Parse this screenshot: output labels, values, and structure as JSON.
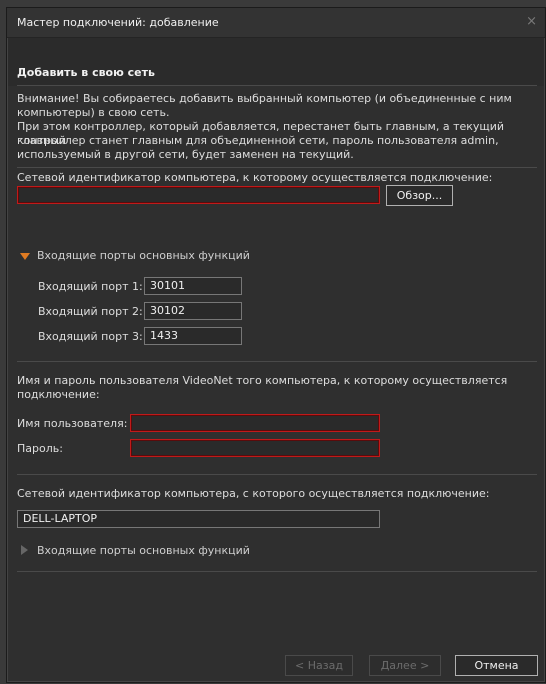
{
  "window": {
    "title": "Мастер подключений: добавление",
    "close_glyph": "×"
  },
  "section": {
    "title": "Добавить в свою сеть"
  },
  "warning": {
    "line1": "Внимание! Вы собираетесь добавить выбранный компьютер (и объединенные с ним",
    "line2": "компьютеры) в свою сеть.",
    "line3": "При этом контроллер, который добавляется, перестанет быть главным, а текущий главный",
    "line4": "контроллер станет главным для объединенной сети, пароль пользователя admin,",
    "line5": "используемый в другой сети, будет заменен на текущий."
  },
  "target": {
    "label": "Сетевой идентификатор компьютера, к которому осуществляется подключение:",
    "value": "",
    "browse_label": "Обзор..."
  },
  "ports_expanded": {
    "label": "Входящие порты основных функций",
    "ports": [
      {
        "label": "Входящий порт 1:",
        "value": "30101"
      },
      {
        "label": "Входящий порт 2:",
        "value": "30102"
      },
      {
        "label": "Входящий порт 3:",
        "value": "1433"
      }
    ]
  },
  "credentials": {
    "info_line1": "Имя и пароль пользователя VideoNet того компьютера, к которому осуществляется",
    "info_line2": "подключение:",
    "username_label": "Имя пользователя:",
    "username_value": "",
    "password_label": "Пароль:",
    "password_value": ""
  },
  "source": {
    "label": "Сетевой идентификатор компьютера, с которого осуществляется подключение:",
    "value": "DELL-LAPTOP"
  },
  "ports_collapsed": {
    "label": "Входящие порты основных функций"
  },
  "footer": {
    "back_label": "< Назад",
    "next_label": "Далее >",
    "cancel_label": "Отмена"
  },
  "colors": {
    "accent_orange": "#e07b22",
    "error_red": "#c01a1a",
    "background": "#2f2f2f"
  },
  "icons": {
    "expanded": "triangle-down-icon",
    "collapsed": "triangle-right-icon",
    "close": "close-icon"
  }
}
